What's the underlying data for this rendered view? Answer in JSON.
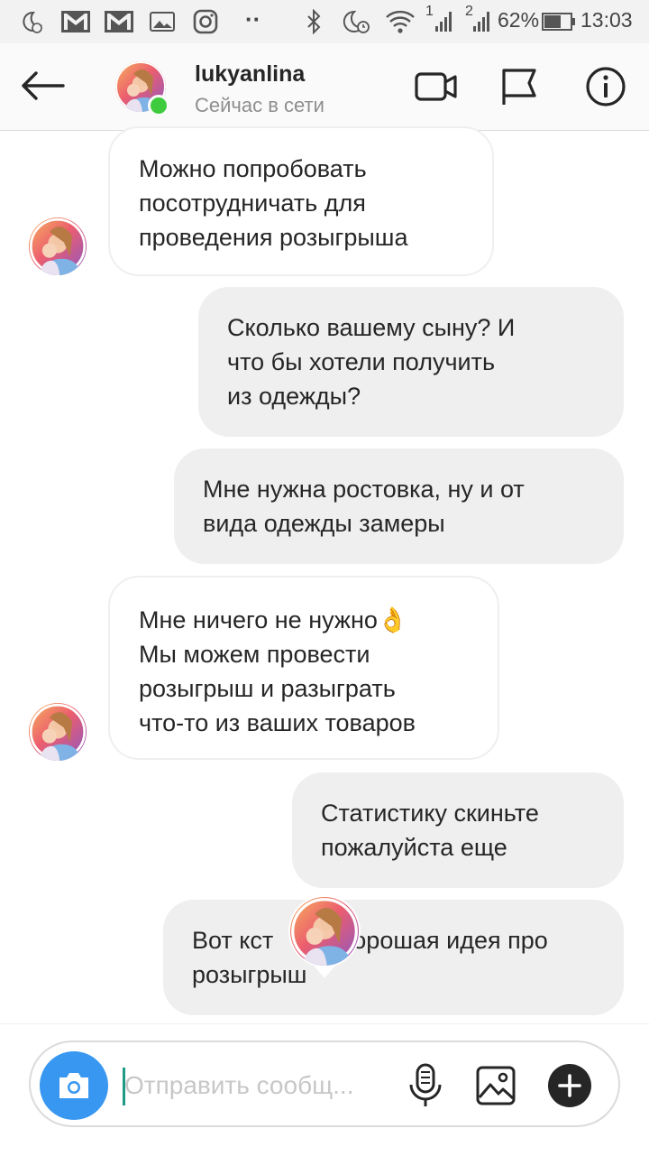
{
  "status_bar": {
    "battery": "62%",
    "time": "13:03",
    "sim1": "1",
    "sim2": "2",
    "dots": "··",
    "icons": [
      "moon-alarm-icon",
      "gmail-icon",
      "gmail-icon",
      "image-icon",
      "instagram-icon",
      "bluetooth-icon",
      "moon-alarm-icon",
      "wifi-icon",
      "signal-icon",
      "signal-icon",
      "battery-icon"
    ]
  },
  "header": {
    "username": "lukyanlina",
    "status": "Сейчас в сети",
    "icons": [
      "back-arrow-icon",
      "video-call-icon",
      "flag-icon",
      "info-icon"
    ]
  },
  "messages": [
    {
      "direction": "in",
      "text": "Можно попробовать\nпосотрудничать для\nпроведения розыгрыша"
    },
    {
      "direction": "out",
      "text": "Сколько вашему сыну? И\nчто бы хотели получить\nиз одежды?"
    },
    {
      "direction": "out",
      "text": "Мне нужна ростовка, ну и от\nвида одежды замеры"
    },
    {
      "direction": "in",
      "text": "Мне ничего не нужно👌\nМы можем провести\nрозыгрыш и разыграть\nчто-то из ваших товаров"
    },
    {
      "direction": "out",
      "text": "Статистику скиньте\nпожалуйста еще"
    },
    {
      "direction": "out",
      "text_visible_left": "Вот кст",
      "text_visible_right": "орошая идея про",
      "text_line2": "розыгрыш"
    }
  ],
  "composer": {
    "placeholder": "Отправить сообщ...",
    "icons": [
      "camera-icon",
      "microphone-icon",
      "gallery-icon",
      "plus-icon"
    ]
  },
  "colors": {
    "accent": "#3897f0",
    "online": "#3ecb3e",
    "bubble_out": "#efefef",
    "bubble_in_border": "#efefef"
  }
}
